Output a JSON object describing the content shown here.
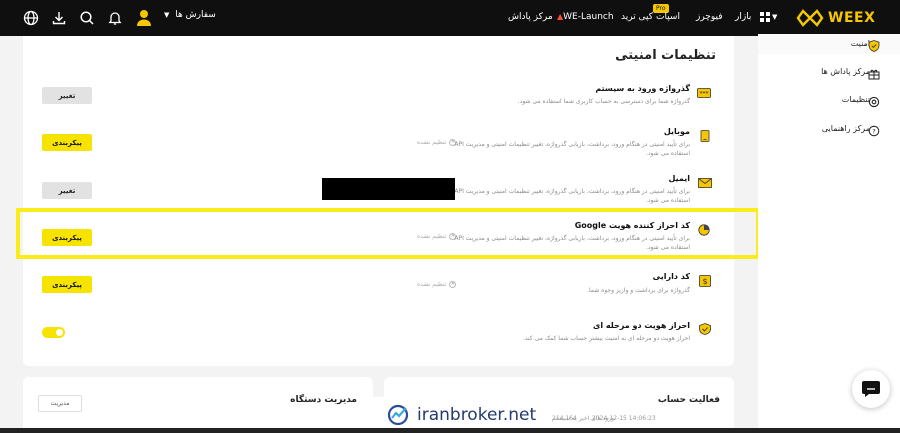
{
  "header": {
    "brand": "WEEX",
    "assets_menu": "سفارش ها",
    "nav": {
      "reward_center": "مرکز پاداش",
      "we_launch": "WE-Launch",
      "copy_trade": "کپی ترید",
      "pro_badge": "Pro",
      "spot": "اسپات",
      "futures": "فیوچرز",
      "market": "بازار"
    }
  },
  "sidebar": {
    "items": [
      {
        "label": "امنیت",
        "icon": "shield-icon"
      },
      {
        "label": "مرکز پاداش ها",
        "icon": "gift-icon"
      },
      {
        "label": "تنظیمات",
        "icon": "settings-icon"
      },
      {
        "label": "مرکز راهنمایی",
        "icon": "help-icon"
      }
    ]
  },
  "security": {
    "title": "تنظیمات امنیتی",
    "rows": [
      {
        "title": "گذرواژه ورود به سیستم",
        "desc": "گذرواژه شما برای دسترسی به حساب کاربری شما استفاده می شود.",
        "status": "",
        "button": "تغییر"
      },
      {
        "title": "موبایل",
        "desc": "برای تأیید امنیتی در هنگام ورود، برداشت، بازیابی گذرواژه، تغییر تنظیمات امنیتی و مدیریت API استفاده می شود.",
        "status": "تنظیم نشده",
        "button": "پیکربندی"
      },
      {
        "title": "ایمیل",
        "desc": "برای تأیید امنیتی در هنگام ورود، برداشت، بازیابی گذرواژه، تغییر تنظیمات امنیتی و مدیریت API استفاده می شود.",
        "status": "",
        "button": "تغییر"
      },
      {
        "title": "کد احراز کننده هویت Google",
        "desc": "برای تأیید امنیتی در هنگام ورود، برداشت، بازیابی گذرواژه، تغییر تنظیمات امنیتی و مدیریت API استفاده می شود.",
        "status": "تنظیم نشده",
        "button": "پیکربندی"
      },
      {
        "title": "کد دارایی",
        "desc": "گذرواژه برای برداشت و واریز وجوه شما.",
        "status": "تنظیم نشده",
        "button": "پیکربندی"
      },
      {
        "title": "احراز هویت دو مرحله ای",
        "desc": "احراز هویت دو مرحله ای به امنیت بیشتر حساب شما کمک می کند.",
        "status": "",
        "button": ""
      }
    ]
  },
  "device": {
    "title": "مدیریت دستگاه",
    "manage_button": "مدیریت"
  },
  "activity": {
    "title": "فعالیت حساب",
    "last_login_label": "ورود های اخیر به سیستم",
    "last_login_time": "2024-12-15 14:06:23",
    "last_login_ip": "214.164"
  },
  "watermark": {
    "text": "iranbroker.net"
  },
  "colors": {
    "accent": "#f6e300",
    "highlight": "#f9ec1a",
    "topbar": "#0f0f0f"
  }
}
